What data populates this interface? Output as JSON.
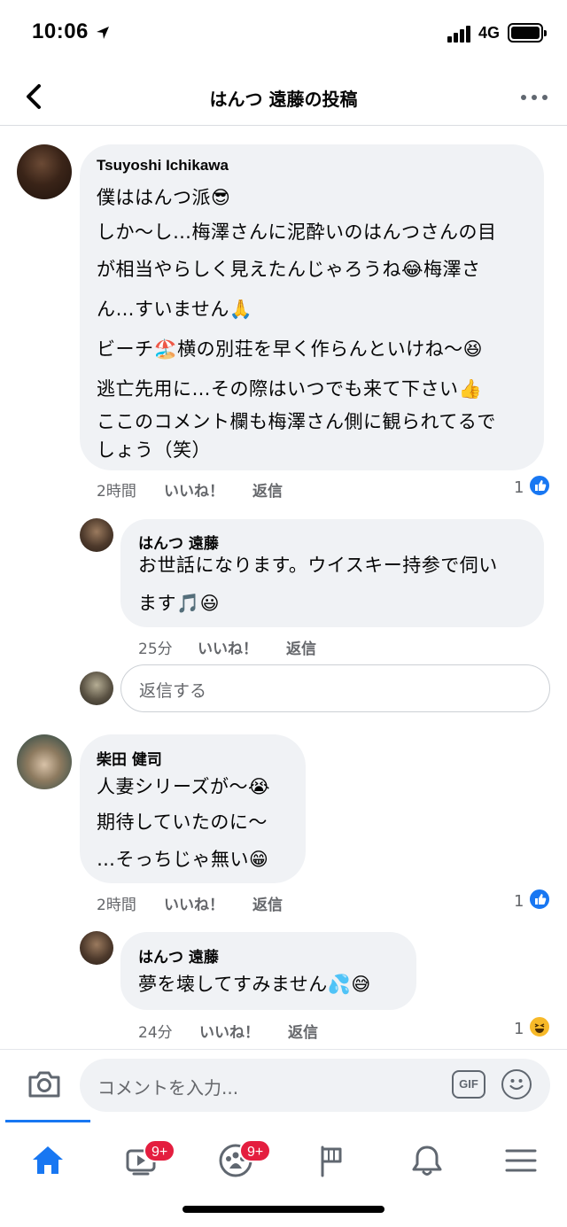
{
  "status": {
    "time": "10:06",
    "network": "4G"
  },
  "header": {
    "title": "はんつ 遠藤の投稿"
  },
  "comments": [
    {
      "name": "Tsuyoshi Ichikawa",
      "lines": [
        "僕ははんつ派😎",
        "しか〜し…梅澤さんに泥酔いのはんつさんの目",
        "が相当やらしく見えたんじゃろうね😂梅澤さ",
        "ん…すいません🙏",
        "ビーチ🏖️横の別荘を早く作らんといけね〜😆",
        "逃亡先用に…その際はいつでも来て下さい👍",
        "ここのコメント欄も梅澤さん側に観られてるで",
        "しょう（笑）"
      ],
      "time": "2時間",
      "like": "いいね！",
      "reply": "返信",
      "reactions": "1"
    },
    {
      "name": "はんつ 遠藤",
      "lines": [
        "お世話になります。ウイスキー持参で伺い",
        "ます🎵😃"
      ],
      "time": "25分",
      "like": "いいね！",
      "reply": "返信"
    },
    {
      "name": "柴田 健司",
      "lines": [
        "人妻シリーズが〜😭",
        "期待していたのに〜",
        "…そっちじゃ無い😁"
      ],
      "time": "2時間",
      "like": "いいね！",
      "reply": "返信",
      "reactions": "1"
    },
    {
      "name": "はんつ 遠藤",
      "lines": [
        "夢を壊してすみません💦😅"
      ],
      "time": "24分",
      "like": "いいね！",
      "reply": "返信",
      "reactions": "1"
    }
  ],
  "reply_input": {
    "placeholder": "返信する"
  },
  "composer": {
    "placeholder": "コメントを入力...",
    "gif_label": "GIF"
  },
  "tabs": [
    {
      "name": "home",
      "icon": "home-icon",
      "active": true
    },
    {
      "name": "watch",
      "icon": "video-icon",
      "badge": "9+"
    },
    {
      "name": "groups",
      "icon": "groups-icon",
      "badge": "9+"
    },
    {
      "name": "pages",
      "icon": "flag-icon"
    },
    {
      "name": "notifications",
      "icon": "bell-icon"
    },
    {
      "name": "menu",
      "icon": "menu-icon"
    }
  ],
  "colors": {
    "accent": "#1877f2",
    "bubble": "#f0f2f5",
    "badge": "#e41e3f",
    "meta": "#65676b"
  }
}
